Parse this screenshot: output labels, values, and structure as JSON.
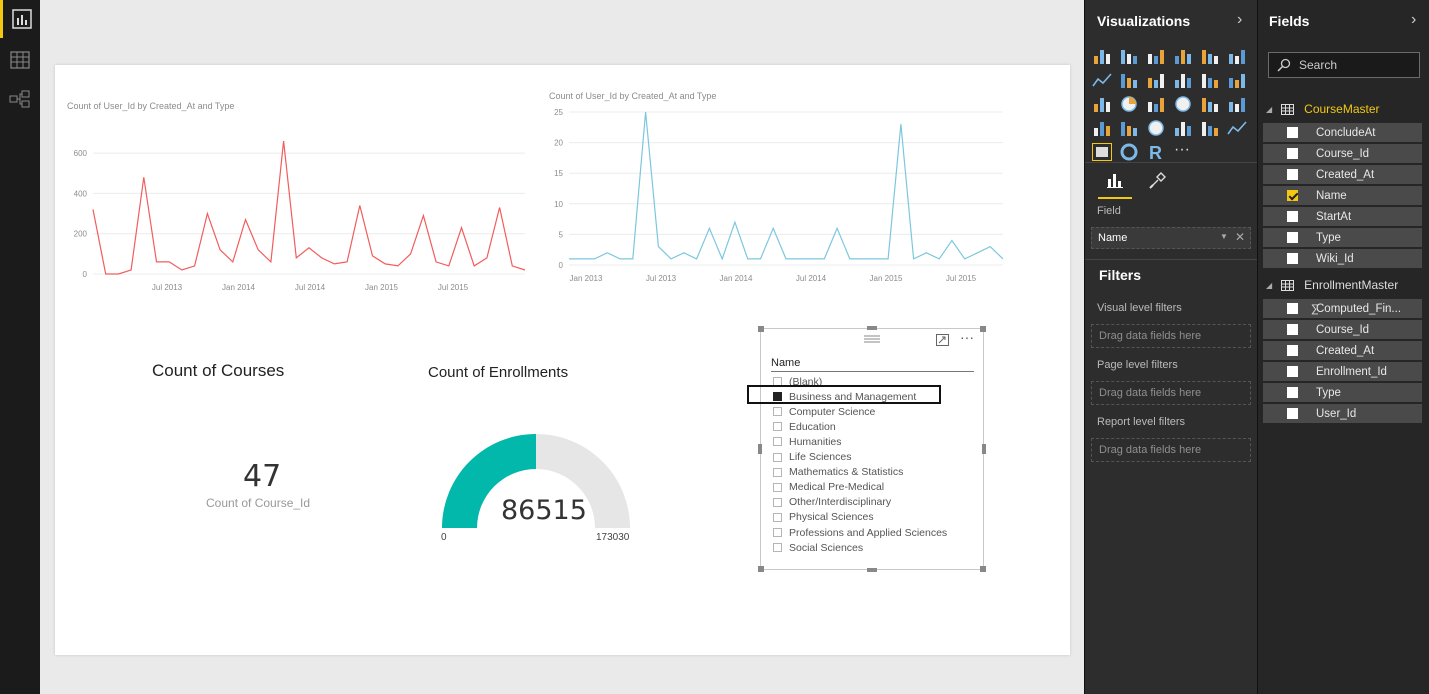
{
  "rail": {
    "icons": [
      "report-view-icon",
      "data-view-icon",
      "relationships-view-icon"
    ]
  },
  "line_chart_red": {
    "title": "Count of User_Id by Created_At and Type",
    "color": "#f25c5c",
    "y_ticks": [
      "600",
      "400",
      "200",
      "0"
    ],
    "x_ticks": [
      "Jul 2013",
      "Jan 2014",
      "Jul 2014",
      "Jan 2015",
      "Jul 2015"
    ]
  },
  "line_chart_blue": {
    "title": "Count of User_Id by Created_At and Type",
    "color": "#7cc7de",
    "y_ticks": [
      "25",
      "20",
      "15",
      "10",
      "5",
      "0"
    ],
    "x_ticks": [
      "Jan 2013",
      "Jul 2013",
      "Jan 2014",
      "Jul 2014",
      "Jan 2015",
      "Jul 2015"
    ]
  },
  "chart_data": [
    {
      "type": "line",
      "title": "Count of User_Id by Created_At and Type",
      "xlabel": "",
      "ylabel": "",
      "ylim": [
        0,
        700
      ],
      "x_tick_labels": [
        "Jul 2013",
        "Jan 2014",
        "Jul 2014",
        "Jan 2015",
        "Jul 2015"
      ],
      "series": [
        {
          "x": [
            "2013-01",
            "2013-02",
            "2013-03",
            "2013-04",
            "2013-05",
            "2013-06",
            "2013-07",
            "2013-08",
            "2013-09",
            "2013-10",
            "2013-11",
            "2013-12",
            "2014-01",
            "2014-02",
            "2014-03",
            "2014-04",
            "2014-05",
            "2014-06",
            "2014-07",
            "2014-08",
            "2014-09",
            "2014-10",
            "2014-11",
            "2014-12",
            "2015-01",
            "2015-02",
            "2015-03",
            "2015-04",
            "2015-05",
            "2015-06",
            "2015-07",
            "2015-08",
            "2015-09",
            "2015-10",
            "2015-11"
          ],
          "values": [
            320,
            0,
            0,
            20,
            480,
            60,
            60,
            20,
            40,
            300,
            120,
            60,
            270,
            120,
            60,
            660,
            80,
            130,
            80,
            50,
            60,
            340,
            90,
            50,
            40,
            100,
            290,
            60,
            40,
            230,
            40,
            80,
            330,
            40,
            20
          ]
        }
      ]
    },
    {
      "type": "line",
      "title": "Count of User_Id by Created_At and Type",
      "xlabel": "",
      "ylabel": "",
      "ylim": [
        0,
        25
      ],
      "x_tick_labels": [
        "Jan 2013",
        "Jul 2013",
        "Jan 2014",
        "Jul 2014",
        "Jan 2015",
        "Jul 2015"
      ],
      "series": [
        {
          "x": [
            "2013-01",
            "2013-02",
            "2013-03",
            "2013-04",
            "2013-05",
            "2013-06",
            "2013-07",
            "2013-08",
            "2013-09",
            "2013-10",
            "2013-11",
            "2013-12",
            "2014-01",
            "2014-02",
            "2014-03",
            "2014-04",
            "2014-05",
            "2014-06",
            "2014-07",
            "2014-08",
            "2014-09",
            "2014-10",
            "2014-11",
            "2014-12",
            "2015-01",
            "2015-02",
            "2015-03",
            "2015-04",
            "2015-05",
            "2015-06",
            "2015-07",
            "2015-08",
            "2015-09",
            "2015-10",
            "2015-11"
          ],
          "values": [
            1,
            1,
            1,
            2,
            1,
            1,
            25,
            3,
            1,
            2,
            1,
            6,
            1,
            7,
            1,
            1,
            6,
            1,
            1,
            1,
            1,
            6,
            1,
            1,
            1,
            1,
            23,
            1,
            2,
            1,
            4,
            1,
            2,
            3,
            1
          ]
        }
      ]
    },
    {
      "type": "gauge",
      "title": "Count of Enrollments",
      "value": 86515,
      "min": 0,
      "max": 173030
    }
  ],
  "card_courses": {
    "title": "Count of Courses",
    "value": "47",
    "label": "Count of Course_Id"
  },
  "gauge": {
    "title": "Count of Enrollments",
    "value": "86515",
    "min": "0",
    "max": "173030",
    "fill_color": "#01b8aa",
    "track_color": "#e6e6e6",
    "fraction": 0.5
  },
  "slicer": {
    "header": "Name",
    "items": [
      {
        "label": "(Blank)",
        "checked": false
      },
      {
        "label": "Business and Management",
        "checked": true
      },
      {
        "label": "Computer Science",
        "checked": false
      },
      {
        "label": "Education",
        "checked": false
      },
      {
        "label": "Humanities",
        "checked": false
      },
      {
        "label": "Life Sciences",
        "checked": false
      },
      {
        "label": "Mathematics & Statistics",
        "checked": false
      },
      {
        "label": "Medical Pre-Medical",
        "checked": false
      },
      {
        "label": "Other/Interdisciplinary",
        "checked": false
      },
      {
        "label": "Physical Sciences",
        "checked": false
      },
      {
        "label": "Professions and Applied Sciences",
        "checked": false
      },
      {
        "label": "Social Sciences",
        "checked": false
      }
    ],
    "more_options": "···"
  },
  "viz_pane": {
    "title": "Visualizations",
    "icons": [
      "stacked-bar-icon",
      "stacked-column-icon",
      "clustered-bar-icon",
      "clustered-column-icon",
      "100-bar-icon",
      "100-column-icon",
      "line-chart-icon",
      "area-chart-icon",
      "stacked-area-icon",
      "line-column-icon",
      "line-clustered-column-icon",
      "ribbon-chart-icon",
      "scatter-chart-icon",
      "pie-chart-icon",
      "treemap-icon",
      "map-icon",
      "table-icon",
      "matrix-icon",
      "waterfall-icon",
      "funnel-icon",
      "gauge-icon",
      "multi-row-card-icon",
      "card-icon",
      "kpi-icon",
      "slicer-icon",
      "donut-icon",
      "r-visual-icon",
      "more-visuals-icon"
    ],
    "r_label": "R",
    "more_label": "···",
    "field_label": "Field",
    "field_value": "Name",
    "filters_title": "Filters",
    "visual_filters": "Visual level filters",
    "page_filters": "Page level filters",
    "report_filters": "Report level filters",
    "drop_text": "Drag data fields here"
  },
  "fields_pane": {
    "title": "Fields",
    "search_placeholder": "Search",
    "tables": [
      {
        "name": "CourseMaster",
        "active": true,
        "fields": [
          {
            "name": "ConcludeAt",
            "checked": false
          },
          {
            "name": "Course_Id",
            "checked": false
          },
          {
            "name": "Created_At",
            "checked": false
          },
          {
            "name": "Name",
            "checked": true
          },
          {
            "name": "StartAt",
            "checked": false
          },
          {
            "name": "Type",
            "checked": false
          },
          {
            "name": "Wiki_Id",
            "checked": false
          }
        ]
      },
      {
        "name": "EnrollmentMaster",
        "active": false,
        "fields": [
          {
            "name": "Computed_Fin...",
            "checked": false,
            "sigma": true
          },
          {
            "name": "Course_Id",
            "checked": false
          },
          {
            "name": "Created_At",
            "checked": false
          },
          {
            "name": "Enrollment_Id",
            "checked": false
          },
          {
            "name": "Type",
            "checked": false
          },
          {
            "name": "User_Id",
            "checked": false
          }
        ]
      }
    ]
  }
}
